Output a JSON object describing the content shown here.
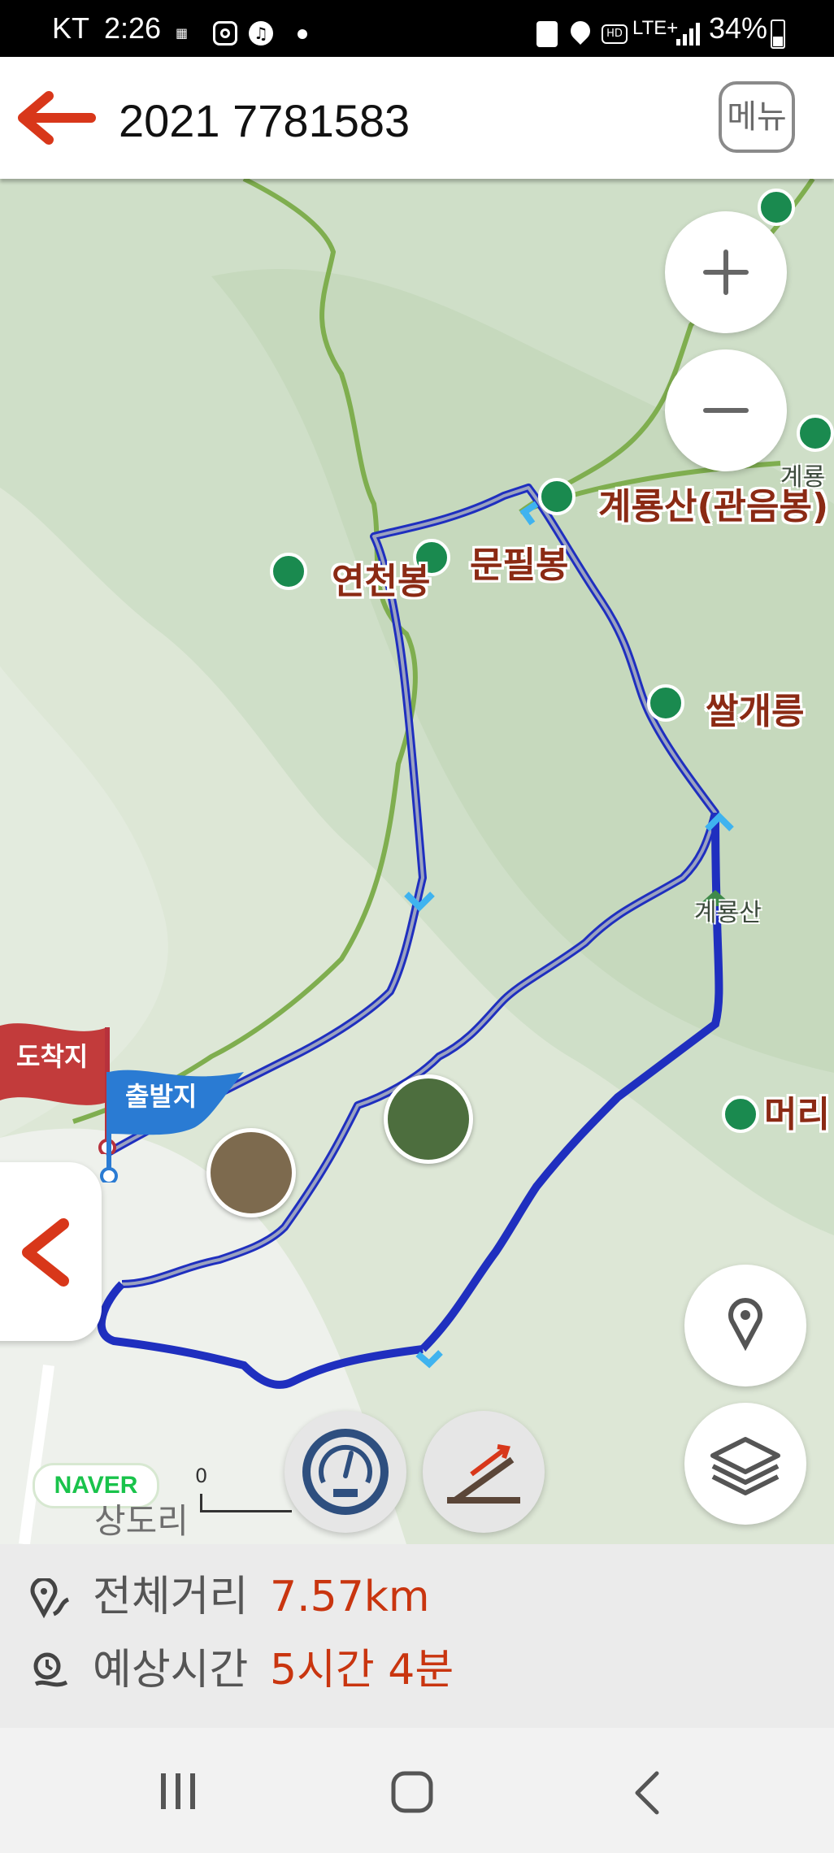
{
  "status_bar": {
    "carrier": "KT",
    "time": "2:26",
    "battery": "34%",
    "icons": [
      "data-saver-icon",
      "instagram-icon",
      "music-icon",
      "dot-icon",
      "recycle-icon",
      "location-icon",
      "hd-icon",
      "lte-plus-icon",
      "signal-icon",
      "battery-icon"
    ],
    "lte_label": "LTE+",
    "hd_label": "HD"
  },
  "header": {
    "title": "2021 7781583",
    "menu_label": "메뉴",
    "accent": "#d8371a"
  },
  "map": {
    "peaks": [
      {
        "name": "연천봉"
      },
      {
        "name": "문필봉"
      },
      {
        "name": "계룡산(관음봉)"
      },
      {
        "name": "쌀개릉"
      },
      {
        "name": "머리"
      }
    ],
    "small_labels": [
      "계룡산",
      "계룡"
    ],
    "flags": {
      "arrival": "도착지",
      "departure": "출발지"
    },
    "attribution": "NAVER",
    "scale_zero": "0",
    "village": "상도리",
    "route_color": "#1f2fbf",
    "trail_color": "#7fae4f"
  },
  "summary": {
    "distance_label": "전체거리",
    "distance_value": "7.57km",
    "time_label": "예상시간",
    "time_value": "5시간 4분"
  }
}
